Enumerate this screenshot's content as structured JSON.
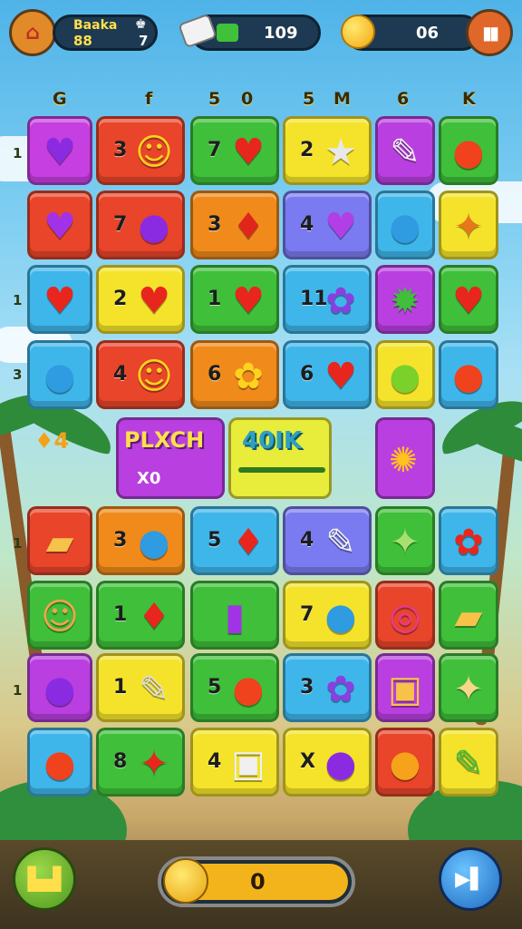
{
  "hud": {
    "player_name": "Baaka",
    "player_icon": "house-icon",
    "level_label": "88",
    "counter_glyph": "♚",
    "counter_value": "7",
    "energy_value": "109",
    "energy_icon": "eraser-icon",
    "coins_value": "06",
    "coins_icon": "coin-icon",
    "pause_icon": "pause-icon"
  },
  "column_headers": [
    "G",
    "f",
    "5",
    "0",
    "5",
    "M",
    "6",
    "K"
  ],
  "row_markers": [
    "1",
    "1",
    "3",
    "1",
    "1"
  ],
  "board": {
    "tiles": [
      {
        "color": "#c63fe0",
        "num": "",
        "icon": "heart-icon",
        "glyph": "♥",
        "icolor": "#8a2be2"
      },
      {
        "color": "#e8452a",
        "num": "3",
        "icon": "smiley-icon",
        "glyph": "☺",
        "icolor": "#ffd21f",
        "wide": true
      },
      {
        "color": "#3fbf3a",
        "num": "7",
        "icon": "heart-icon",
        "glyph": "♥",
        "icolor": "#e8261d"
      },
      {
        "color": "#f4e32a",
        "num": "2",
        "icon": "star-icon",
        "glyph": "★",
        "icolor": "#e8e8e8"
      },
      {
        "color": "#b93fe0",
        "num": "",
        "icon": "pencil-icon",
        "glyph": "✎",
        "icolor": "#f0f0f0"
      },
      {
        "color": "#3fbf3a",
        "num": "",
        "icon": "tomato-icon",
        "glyph": "●",
        "icolor": "#f0421d"
      },
      {
        "color": "#e8452a",
        "num": "",
        "icon": "heart-icon",
        "glyph": "♥",
        "icolor": "#a232e6"
      },
      {
        "color": "#e8452a",
        "num": "7",
        "icon": "candy-icon",
        "glyph": "●",
        "icolor": "#8a2be2",
        "wide": true
      },
      {
        "color": "#f08a1a",
        "num": "3",
        "icon": "pepper-icon",
        "glyph": "♦",
        "icolor": "#e0251d"
      },
      {
        "color": "#7a7bf0",
        "num": "4",
        "icon": "heart-icon",
        "glyph": "♥",
        "icolor": "#b23ee6"
      },
      {
        "color": "#3fb6ea",
        "num": "",
        "icon": "balloon-icon",
        "glyph": "●",
        "icolor": "#2f9be0"
      },
      {
        "color": "#f4e32a",
        "num": "",
        "icon": "carrot-icon",
        "glyph": "✦",
        "icolor": "#e8761a"
      },
      {
        "color": "#3fb6ea",
        "num": "",
        "icon": "heart-icon",
        "glyph": "♥",
        "icolor": "#e8261d"
      },
      {
        "color": "#f4e32a",
        "num": "2",
        "icon": "heart-icon",
        "glyph": "♥",
        "icolor": "#e8261d",
        "wide": true
      },
      {
        "color": "#3fbf3a",
        "num": "1",
        "icon": "heart-icon",
        "glyph": "♥",
        "icolor": "#e8261d"
      },
      {
        "color": "#3fb6ea",
        "num": "11",
        "icon": "flower-icon",
        "glyph": "✿",
        "icolor": "#8a3fe0"
      },
      {
        "color": "#b93fe0",
        "num": "",
        "icon": "gear-icon",
        "glyph": "✹",
        "icolor": "#3fbf3a"
      },
      {
        "color": "#3fbf3a",
        "num": "",
        "icon": "heart-icon",
        "glyph": "♥",
        "icolor": "#e8261d"
      },
      {
        "color": "#3fb6ea",
        "num": "",
        "icon": "balloon-icon",
        "glyph": "●",
        "icolor": "#2f9be0"
      },
      {
        "color": "#e8452a",
        "num": "4",
        "icon": "smiley-icon",
        "glyph": "☺",
        "icolor": "#ffd21f",
        "wide": true
      },
      {
        "color": "#f08a1a",
        "num": "6",
        "icon": "pineapple-icon",
        "glyph": "✿",
        "icolor": "#ffd21f"
      },
      {
        "color": "#3fb6ea",
        "num": "6",
        "icon": "heart-icon",
        "glyph": "♥",
        "icolor": "#e8261d"
      },
      {
        "color": "#f4e32a",
        "num": "",
        "icon": "lime-icon",
        "glyph": "●",
        "icolor": "#7ad12a"
      },
      {
        "color": "#3fb6ea",
        "num": "",
        "icon": "tomato-icon",
        "glyph": "●",
        "icolor": "#f0421d"
      },
      {
        "color": "#e8452a",
        "num": "",
        "icon": "bandage-icon",
        "glyph": "▰",
        "icolor": "#f6c24a"
      },
      {
        "color": "#f08a1a",
        "num": "3",
        "icon": "balloon-icon",
        "glyph": "●",
        "icolor": "#2f9be0",
        "wide": true
      },
      {
        "color": "#3fb6ea",
        "num": "5",
        "icon": "pepper-icon",
        "glyph": "♦",
        "icolor": "#e8261d"
      },
      {
        "color": "#7a7bf0",
        "num": "4",
        "icon": "pencil-icon",
        "glyph": "✎",
        "icolor": "#f0f0f0"
      },
      {
        "color": "#3fbf3a",
        "num": "",
        "icon": "brush-icon",
        "glyph": "✦",
        "icolor": "#a8e070"
      },
      {
        "color": "#3fb6ea",
        "num": "",
        "icon": "flower-icon",
        "glyph": "✿",
        "icolor": "#e8261d"
      },
      {
        "color": "#3fbf3a",
        "num": "",
        "icon": "face-icon",
        "glyph": "☺",
        "icolor": "#f6a24a"
      },
      {
        "color": "#3fbf3a",
        "num": "1",
        "icon": "pepper-icon",
        "glyph": "♦",
        "icolor": "#e8261d",
        "wide": true
      },
      {
        "color": "#3fbf3a",
        "num": "",
        "icon": "jar-icon",
        "glyph": "▮",
        "icolor": "#a232e6"
      },
      {
        "color": "#f4e32a",
        "num": "7",
        "icon": "balloon-icon",
        "glyph": "●",
        "icolor": "#2f9be0"
      },
      {
        "color": "#e8452a",
        "num": "",
        "icon": "spiral-icon",
        "glyph": "◎",
        "icolor": "#e83a8a"
      },
      {
        "color": "#3fbf3a",
        "num": "",
        "icon": "cheese-icon",
        "glyph": "▰",
        "icolor": "#f6c24a"
      },
      {
        "color": "#b93fe0",
        "num": "",
        "icon": "lollipop-icon",
        "glyph": "●",
        "icolor": "#8a2be2"
      },
      {
        "color": "#f4e32a",
        "num": "1",
        "icon": "pencil-icon",
        "glyph": "✎",
        "icolor": "#dcdcdc",
        "wide": true
      },
      {
        "color": "#3fbf3a",
        "num": "5",
        "icon": "tomato-icon",
        "glyph": "●",
        "icolor": "#f0421d"
      },
      {
        "color": "#3fb6ea",
        "num": "3",
        "icon": "flower-icon",
        "glyph": "✿",
        "icolor": "#8a3fe0"
      },
      {
        "color": "#b93fe0",
        "num": "",
        "icon": "box-icon",
        "glyph": "▣",
        "icolor": "#f6c24a"
      },
      {
        "color": "#3fbf3a",
        "num": "",
        "icon": "star-icon",
        "glyph": "✦",
        "icolor": "#f6d78a"
      },
      {
        "color": "#3fb6ea",
        "num": "",
        "icon": "tomato-icon",
        "glyph": "●",
        "icolor": "#f0421d"
      },
      {
        "color": "#3fbf3a",
        "num": "8",
        "icon": "fries-icon",
        "glyph": "✦",
        "icolor": "#e8261d",
        "wide": true
      },
      {
        "color": "#f4e32a",
        "num": "4",
        "icon": "gift-icon",
        "glyph": "▣",
        "icolor": "#f0f0f0"
      },
      {
        "color": "#f4e32a",
        "num": "X",
        "icon": "candy-icon",
        "glyph": "●",
        "icolor": "#8a2be2"
      },
      {
        "color": "#e8452a",
        "num": "",
        "icon": "chick-icon",
        "glyph": "●",
        "icolor": "#f6a21a"
      },
      {
        "color": "#f4e32a",
        "num": "",
        "icon": "pencil-icon",
        "glyph": "✎",
        "icolor": "#3fbf3a"
      }
    ]
  },
  "bonus_banner": {
    "left_title": "PLXCH",
    "left_sub": "X0",
    "right_title": "40IK",
    "side_icon": "fire-icon",
    "side_glyph": "✺"
  },
  "side_items": {
    "glyph": "♦4",
    "icon": "gem-icon"
  },
  "footer": {
    "left_icon": "buildings-icon",
    "left_glyph": "▙▟",
    "progress_value": "0",
    "progress_icon": "leaf-icon",
    "right_icon": "skip-icon",
    "right_glyph": "▶▌"
  }
}
